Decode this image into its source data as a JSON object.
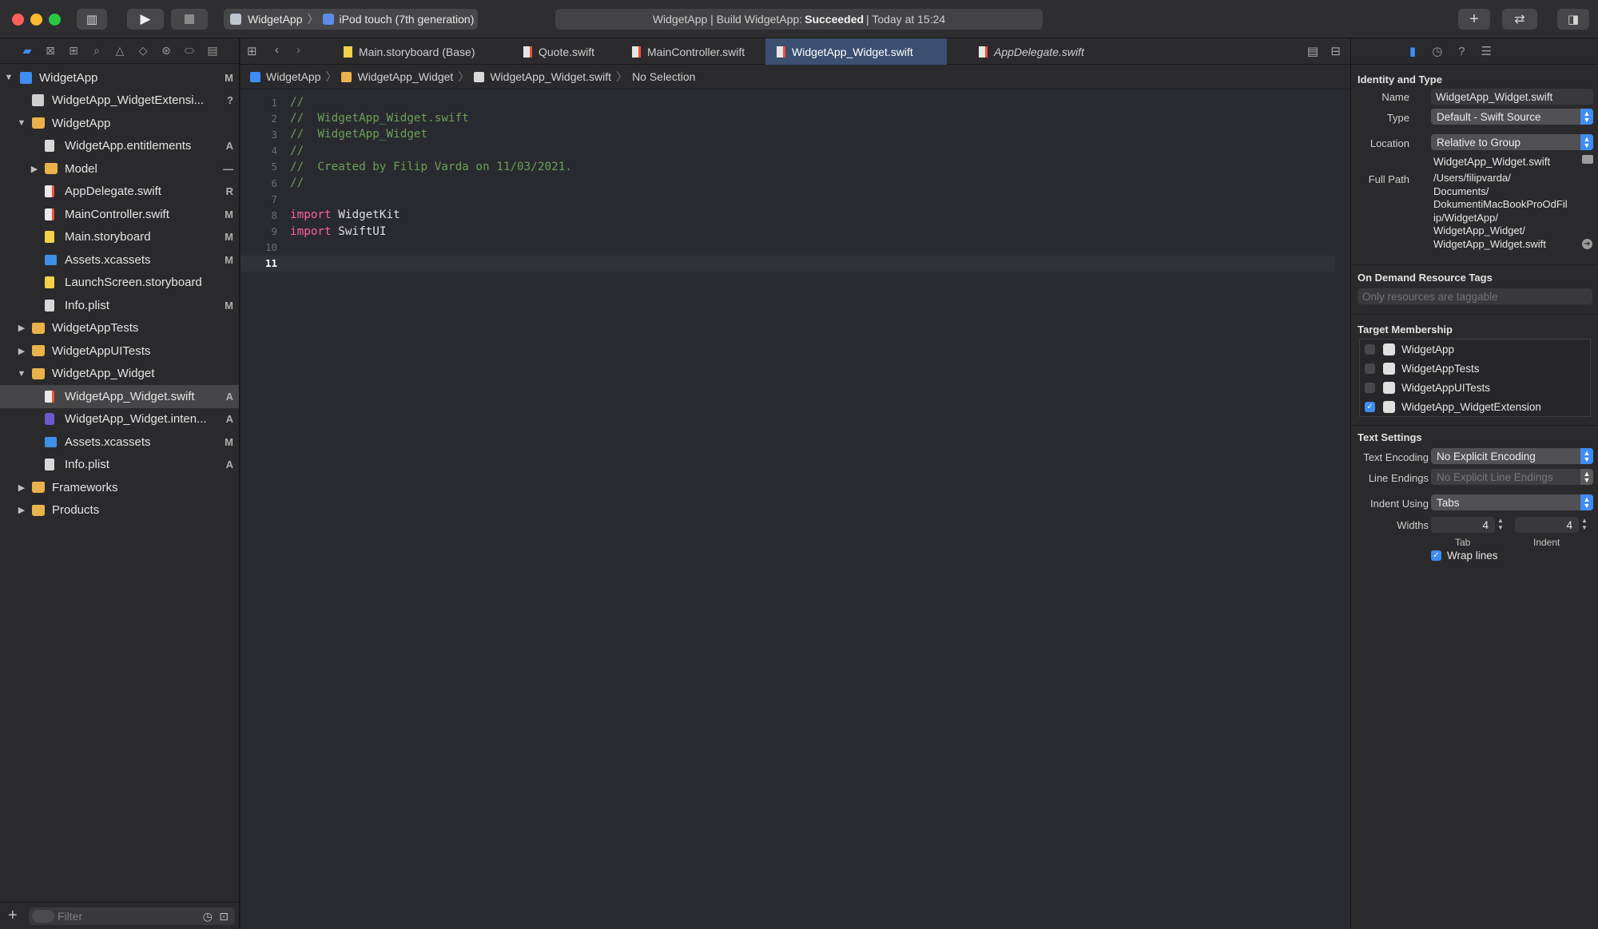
{
  "toolbar": {
    "scheme_name": "WidgetApp",
    "device_name": "iPod touch (7th generation)",
    "activity_prefix": "WidgetApp | Build WidgetApp:",
    "activity_status": "Succeeded",
    "activity_suffix": "| Today at 15:24"
  },
  "navigator": {
    "tree": [
      {
        "label": "WidgetApp",
        "badge": "M",
        "icon": "project-icon",
        "depth": 0,
        "disclosure": "open"
      },
      {
        "label": "WidgetApp_WidgetExtensi...",
        "badge": "?",
        "icon": "extension-icon",
        "depth": 1,
        "disclosure": ""
      },
      {
        "label": "WidgetApp",
        "badge": "",
        "icon": "folder-icon",
        "depth": 1,
        "disclosure": "open"
      },
      {
        "label": "WidgetApp.entitlements",
        "badge": "A",
        "icon": "file-icon",
        "depth": 2,
        "disclosure": ""
      },
      {
        "label": "Model",
        "badge": "—",
        "icon": "folder-icon",
        "depth": 2,
        "disclosure": "closed"
      },
      {
        "label": "AppDelegate.swift",
        "badge": "R",
        "icon": "swift-file-icon",
        "depth": 2,
        "disclosure": ""
      },
      {
        "label": "MainController.swift",
        "badge": "M",
        "icon": "swift-file-icon",
        "depth": 2,
        "disclosure": ""
      },
      {
        "label": "Main.storyboard",
        "badge": "M",
        "icon": "storyboard-icon",
        "depth": 2,
        "disclosure": ""
      },
      {
        "label": "Assets.xcassets",
        "badge": "M",
        "icon": "assets-icon",
        "depth": 2,
        "disclosure": ""
      },
      {
        "label": "LaunchScreen.storyboard",
        "badge": "",
        "icon": "storyboard-icon",
        "depth": 2,
        "disclosure": ""
      },
      {
        "label": "Info.plist",
        "badge": "M",
        "icon": "file-icon",
        "depth": 2,
        "disclosure": ""
      },
      {
        "label": "WidgetAppTests",
        "badge": "",
        "icon": "folder-icon",
        "depth": 1,
        "disclosure": "closed"
      },
      {
        "label": "WidgetAppUITests",
        "badge": "",
        "icon": "folder-icon",
        "depth": 1,
        "disclosure": "closed"
      },
      {
        "label": "WidgetApp_Widget",
        "badge": "",
        "icon": "folder-icon",
        "depth": 1,
        "disclosure": "open"
      },
      {
        "label": "WidgetApp_Widget.swift",
        "badge": "A",
        "icon": "swift-file-icon",
        "depth": 2,
        "disclosure": "",
        "selected": true
      },
      {
        "label": "WidgetApp_Widget.inten...",
        "badge": "A",
        "icon": "intent-icon",
        "depth": 2,
        "disclosure": ""
      },
      {
        "label": "Assets.xcassets",
        "badge": "M",
        "icon": "assets-icon",
        "depth": 2,
        "disclosure": ""
      },
      {
        "label": "Info.plist",
        "badge": "A",
        "icon": "file-icon",
        "depth": 2,
        "disclosure": ""
      },
      {
        "label": "Frameworks",
        "badge": "",
        "icon": "folder-icon",
        "depth": 1,
        "disclosure": "closed"
      },
      {
        "label": "Products",
        "badge": "",
        "icon": "folder-icon",
        "depth": 1,
        "disclosure": "closed"
      }
    ],
    "filter_placeholder": "Filter"
  },
  "editor": {
    "tabs": [
      {
        "label": "Main.storyboard (Base)",
        "kind": "storyboard"
      },
      {
        "label": "Quote.swift",
        "kind": "swift"
      },
      {
        "label": "MainController.swift",
        "kind": "swift"
      },
      {
        "label": "WidgetApp_Widget.swift",
        "kind": "swift",
        "active": true
      },
      {
        "label": "AppDelegate.swift",
        "kind": "swift",
        "italic": true
      }
    ],
    "jumpbar": [
      "WidgetApp",
      "WidgetApp_Widget",
      "WidgetApp_Widget.swift",
      "No Selection"
    ],
    "lines": [
      {
        "n": "1",
        "parts": [
          {
            "c": "cm",
            "t": "//"
          }
        ]
      },
      {
        "n": "2",
        "parts": [
          {
            "c": "cm",
            "t": "//  WidgetApp_Widget.swift"
          }
        ]
      },
      {
        "n": "3",
        "parts": [
          {
            "c": "cm",
            "t": "//  WidgetApp_Widget"
          }
        ]
      },
      {
        "n": "4",
        "parts": [
          {
            "c": "cm",
            "t": "//"
          }
        ]
      },
      {
        "n": "5",
        "parts": [
          {
            "c": "cm",
            "t": "//  Created by Filip Varda on 11/03/2021."
          }
        ]
      },
      {
        "n": "6",
        "parts": [
          {
            "c": "cm",
            "t": "//"
          }
        ]
      },
      {
        "n": "7",
        "parts": []
      },
      {
        "n": "8",
        "parts": [
          {
            "c": "kw",
            "t": "import"
          },
          {
            "c": "",
            "t": " WidgetKit"
          }
        ]
      },
      {
        "n": "9",
        "parts": [
          {
            "c": "kw",
            "t": "import"
          },
          {
            "c": "",
            "t": " SwiftUI"
          }
        ]
      },
      {
        "n": "10",
        "parts": []
      },
      {
        "n": "11",
        "parts": [],
        "current": true
      }
    ]
  },
  "inspector": {
    "identity_title": "Identity and Type",
    "name_label": "Name",
    "name_value": "WidgetApp_Widget.swift",
    "type_label": "Type",
    "type_value": "Default - Swift Source",
    "location_label": "Location",
    "location_value": "Relative to Group",
    "location_file": "WidgetApp_Widget.swift",
    "fullpath_label": "Full Path",
    "fullpath_lines": [
      "/Users/filipvarda/",
      "Documents/",
      "DokumentiMacBookProOdFil",
      "ip/WidgetApp/",
      "WidgetApp_Widget/",
      "WidgetApp_Widget.swift"
    ],
    "ondemand_title": "On Demand Resource Tags",
    "ondemand_placeholder": "Only resources are taggable",
    "target_title": "Target Membership",
    "targets": [
      {
        "label": "WidgetApp",
        "checked": false
      },
      {
        "label": "WidgetAppTests",
        "checked": false
      },
      {
        "label": "WidgetAppUITests",
        "checked": false
      },
      {
        "label": "WidgetApp_WidgetExtension",
        "checked": true
      }
    ],
    "text_title": "Text Settings",
    "encoding_label": "Text Encoding",
    "encoding_value": "No Explicit Encoding",
    "endings_label": "Line Endings",
    "endings_value": "No Explicit Line Endings",
    "indent_label": "Indent Using",
    "indent_value": "Tabs",
    "widths_label": "Widths",
    "tab_width": "4",
    "indent_width": "4",
    "tab_caption": "Tab",
    "indent_caption": "Indent",
    "wrap_label": "Wrap lines"
  },
  "colors": {
    "accent": "#3d8df5",
    "comment": "#6c9f55",
    "keyword": "#fc5fa3",
    "folder": "#e9b24a"
  }
}
